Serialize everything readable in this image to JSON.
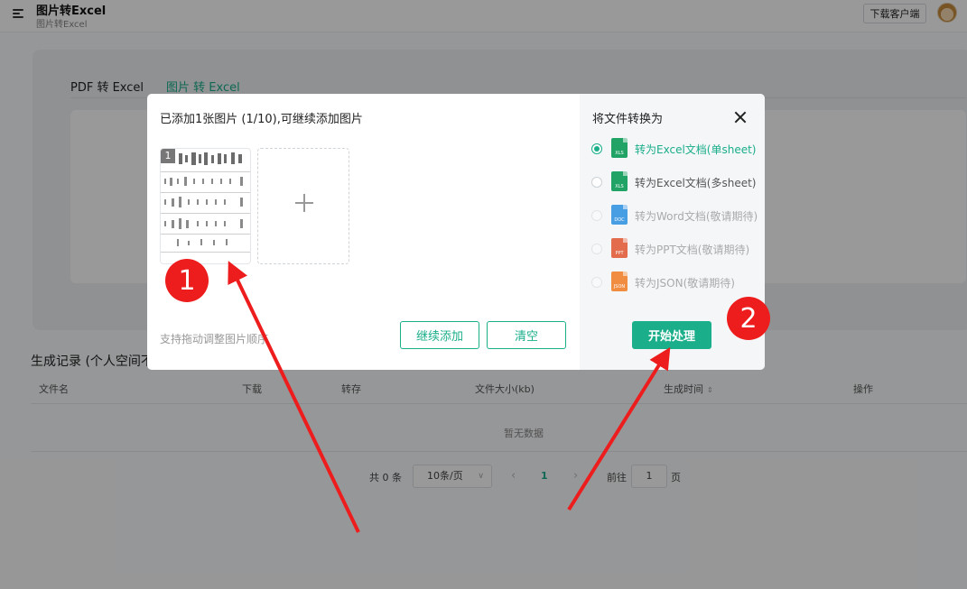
{
  "app": {
    "title": "图片转Excel",
    "subtitle": "图片转Excel",
    "download_client_label": "下载客户端"
  },
  "background": {
    "tabs": [
      {
        "label": "PDF 转 Excel",
        "active": false
      },
      {
        "label": "图片 转 Excel",
        "active": true
      }
    ],
    "records_title": "生成记录 (个人空间不",
    "table": {
      "headers": [
        "文件名",
        "下载",
        "转存",
        "文件大小(kb)",
        "生成时间",
        "操作"
      ],
      "empty_text": "暂无数据"
    },
    "pagination": {
      "total_text": "共 0 条",
      "page_size": "10条/页",
      "current_page": "1",
      "goto_label": "前往",
      "goto_value": "1",
      "page_suffix": "页"
    }
  },
  "dialog": {
    "title": "已添加1张图片 (1/10),可继续添加图片",
    "thumbnail_index": "1",
    "drag_hint": "支持拖动调整图片顺序",
    "continue_label": "继续添加",
    "clear_label": "清空",
    "convert_title": "将文件转换为",
    "options": [
      {
        "label": "转为Excel文档(单sheet)",
        "icon": "xls-file-icon",
        "icon_text": "XLS",
        "color": "#21a366",
        "checked": true,
        "disabled": false
      },
      {
        "label": "转为Excel文档(多sheet)",
        "icon": "xls-file-icon",
        "icon_text": "XLS",
        "color": "#21a366",
        "checked": false,
        "disabled": false
      },
      {
        "label": "转为Word文档(敬请期待)",
        "icon": "doc-file-icon",
        "icon_text": "DOC",
        "color": "#2b8fe0",
        "checked": false,
        "disabled": true
      },
      {
        "label": "转为PPT文档(敬请期待)",
        "icon": "ppt-file-icon",
        "icon_text": "PPT",
        "color": "#e0552d",
        "checked": false,
        "disabled": true
      },
      {
        "label": "转为JSON(敬请期待)",
        "icon": "json-file-icon",
        "icon_text": "JSON",
        "color": "#f07b22",
        "checked": false,
        "disabled": true
      }
    ],
    "start_label": "开始处理"
  },
  "annotations": {
    "marker_1": "1",
    "marker_2": "2",
    "color": "#ee1d1d"
  }
}
